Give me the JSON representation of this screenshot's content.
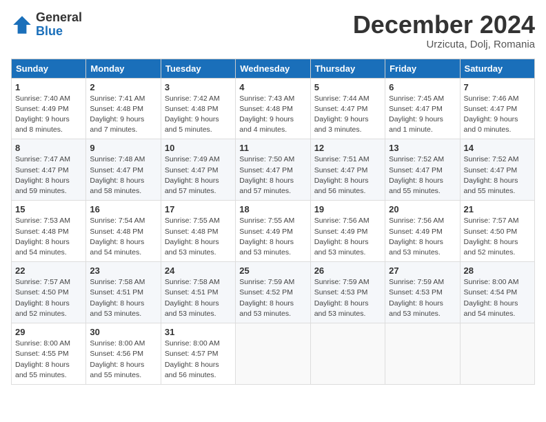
{
  "logo": {
    "general": "General",
    "blue": "Blue"
  },
  "header": {
    "title": "December 2024",
    "subtitle": "Urzicuta, Dolj, Romania"
  },
  "days_of_week": [
    "Sunday",
    "Monday",
    "Tuesday",
    "Wednesday",
    "Thursday",
    "Friday",
    "Saturday"
  ],
  "weeks": [
    [
      {
        "day": "1",
        "sunrise": "Sunrise: 7:40 AM",
        "sunset": "Sunset: 4:49 PM",
        "daylight": "Daylight: 9 hours and 8 minutes."
      },
      {
        "day": "2",
        "sunrise": "Sunrise: 7:41 AM",
        "sunset": "Sunset: 4:48 PM",
        "daylight": "Daylight: 9 hours and 7 minutes."
      },
      {
        "day": "3",
        "sunrise": "Sunrise: 7:42 AM",
        "sunset": "Sunset: 4:48 PM",
        "daylight": "Daylight: 9 hours and 5 minutes."
      },
      {
        "day": "4",
        "sunrise": "Sunrise: 7:43 AM",
        "sunset": "Sunset: 4:48 PM",
        "daylight": "Daylight: 9 hours and 4 minutes."
      },
      {
        "day": "5",
        "sunrise": "Sunrise: 7:44 AM",
        "sunset": "Sunset: 4:47 PM",
        "daylight": "Daylight: 9 hours and 3 minutes."
      },
      {
        "day": "6",
        "sunrise": "Sunrise: 7:45 AM",
        "sunset": "Sunset: 4:47 PM",
        "daylight": "Daylight: 9 hours and 1 minute."
      },
      {
        "day": "7",
        "sunrise": "Sunrise: 7:46 AM",
        "sunset": "Sunset: 4:47 PM",
        "daylight": "Daylight: 9 hours and 0 minutes."
      }
    ],
    [
      {
        "day": "8",
        "sunrise": "Sunrise: 7:47 AM",
        "sunset": "Sunset: 4:47 PM",
        "daylight": "Daylight: 8 hours and 59 minutes."
      },
      {
        "day": "9",
        "sunrise": "Sunrise: 7:48 AM",
        "sunset": "Sunset: 4:47 PM",
        "daylight": "Daylight: 8 hours and 58 minutes."
      },
      {
        "day": "10",
        "sunrise": "Sunrise: 7:49 AM",
        "sunset": "Sunset: 4:47 PM",
        "daylight": "Daylight: 8 hours and 57 minutes."
      },
      {
        "day": "11",
        "sunrise": "Sunrise: 7:50 AM",
        "sunset": "Sunset: 4:47 PM",
        "daylight": "Daylight: 8 hours and 57 minutes."
      },
      {
        "day": "12",
        "sunrise": "Sunrise: 7:51 AM",
        "sunset": "Sunset: 4:47 PM",
        "daylight": "Daylight: 8 hours and 56 minutes."
      },
      {
        "day": "13",
        "sunrise": "Sunrise: 7:52 AM",
        "sunset": "Sunset: 4:47 PM",
        "daylight": "Daylight: 8 hours and 55 minutes."
      },
      {
        "day": "14",
        "sunrise": "Sunrise: 7:52 AM",
        "sunset": "Sunset: 4:47 PM",
        "daylight": "Daylight: 8 hours and 55 minutes."
      }
    ],
    [
      {
        "day": "15",
        "sunrise": "Sunrise: 7:53 AM",
        "sunset": "Sunset: 4:48 PM",
        "daylight": "Daylight: 8 hours and 54 minutes."
      },
      {
        "day": "16",
        "sunrise": "Sunrise: 7:54 AM",
        "sunset": "Sunset: 4:48 PM",
        "daylight": "Daylight: 8 hours and 54 minutes."
      },
      {
        "day": "17",
        "sunrise": "Sunrise: 7:55 AM",
        "sunset": "Sunset: 4:48 PM",
        "daylight": "Daylight: 8 hours and 53 minutes."
      },
      {
        "day": "18",
        "sunrise": "Sunrise: 7:55 AM",
        "sunset": "Sunset: 4:49 PM",
        "daylight": "Daylight: 8 hours and 53 minutes."
      },
      {
        "day": "19",
        "sunrise": "Sunrise: 7:56 AM",
        "sunset": "Sunset: 4:49 PM",
        "daylight": "Daylight: 8 hours and 53 minutes."
      },
      {
        "day": "20",
        "sunrise": "Sunrise: 7:56 AM",
        "sunset": "Sunset: 4:49 PM",
        "daylight": "Daylight: 8 hours and 53 minutes."
      },
      {
        "day": "21",
        "sunrise": "Sunrise: 7:57 AM",
        "sunset": "Sunset: 4:50 PM",
        "daylight": "Daylight: 8 hours and 52 minutes."
      }
    ],
    [
      {
        "day": "22",
        "sunrise": "Sunrise: 7:57 AM",
        "sunset": "Sunset: 4:50 PM",
        "daylight": "Daylight: 8 hours and 52 minutes."
      },
      {
        "day": "23",
        "sunrise": "Sunrise: 7:58 AM",
        "sunset": "Sunset: 4:51 PM",
        "daylight": "Daylight: 8 hours and 53 minutes."
      },
      {
        "day": "24",
        "sunrise": "Sunrise: 7:58 AM",
        "sunset": "Sunset: 4:51 PM",
        "daylight": "Daylight: 8 hours and 53 minutes."
      },
      {
        "day": "25",
        "sunrise": "Sunrise: 7:59 AM",
        "sunset": "Sunset: 4:52 PM",
        "daylight": "Daylight: 8 hours and 53 minutes."
      },
      {
        "day": "26",
        "sunrise": "Sunrise: 7:59 AM",
        "sunset": "Sunset: 4:53 PM",
        "daylight": "Daylight: 8 hours and 53 minutes."
      },
      {
        "day": "27",
        "sunrise": "Sunrise: 7:59 AM",
        "sunset": "Sunset: 4:53 PM",
        "daylight": "Daylight: 8 hours and 53 minutes."
      },
      {
        "day": "28",
        "sunrise": "Sunrise: 8:00 AM",
        "sunset": "Sunset: 4:54 PM",
        "daylight": "Daylight: 8 hours and 54 minutes."
      }
    ],
    [
      {
        "day": "29",
        "sunrise": "Sunrise: 8:00 AM",
        "sunset": "Sunset: 4:55 PM",
        "daylight": "Daylight: 8 hours and 55 minutes."
      },
      {
        "day": "30",
        "sunrise": "Sunrise: 8:00 AM",
        "sunset": "Sunset: 4:56 PM",
        "daylight": "Daylight: 8 hours and 55 minutes."
      },
      {
        "day": "31",
        "sunrise": "Sunrise: 8:00 AM",
        "sunset": "Sunset: 4:57 PM",
        "daylight": "Daylight: 8 hours and 56 minutes."
      },
      null,
      null,
      null,
      null
    ]
  ]
}
